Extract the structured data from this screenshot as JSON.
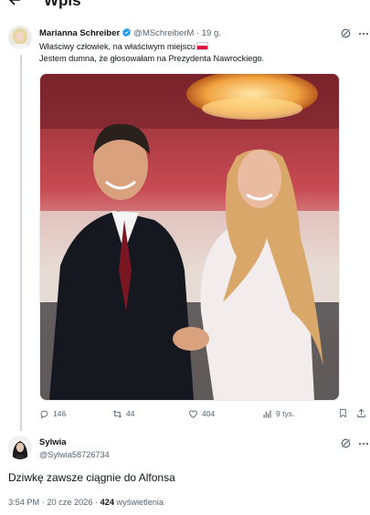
{
  "header": {
    "title": "Wpis",
    "back_icon": "arrow-left-icon"
  },
  "post": {
    "author_name": "Marianna Schreiber",
    "handle": "@MSchreiberM",
    "time": "· 19 g.",
    "line1": "Właściwy człowiek, na właściwym miejscu",
    "line2": "Jestem dumna, że głosowałam na Prezydenta Nawrockiego.",
    "flag_colors": [
      "#ffffff",
      "#dc143c"
    ],
    "verified_color": "#1d9bf0",
    "stats": {
      "replies": "146",
      "reposts": "44",
      "likes": "404",
      "views": "9 tys."
    }
  },
  "reply": {
    "author_name": "Sylwia",
    "handle": "@Sylwia58726734",
    "text": "Dziwkę zawsze ciągnie do Alfonsa",
    "timestamp": "3:54 PM · 20 cze 2026 · ",
    "views_count": "424",
    "views_label": " wyświetlenia"
  },
  "icons": [
    "arrow-left-icon",
    "verified-badge-icon",
    "grok-icon",
    "more-icon",
    "reply-icon",
    "repost-icon",
    "like-icon",
    "views-icon",
    "bookmark-icon",
    "share-icon"
  ]
}
